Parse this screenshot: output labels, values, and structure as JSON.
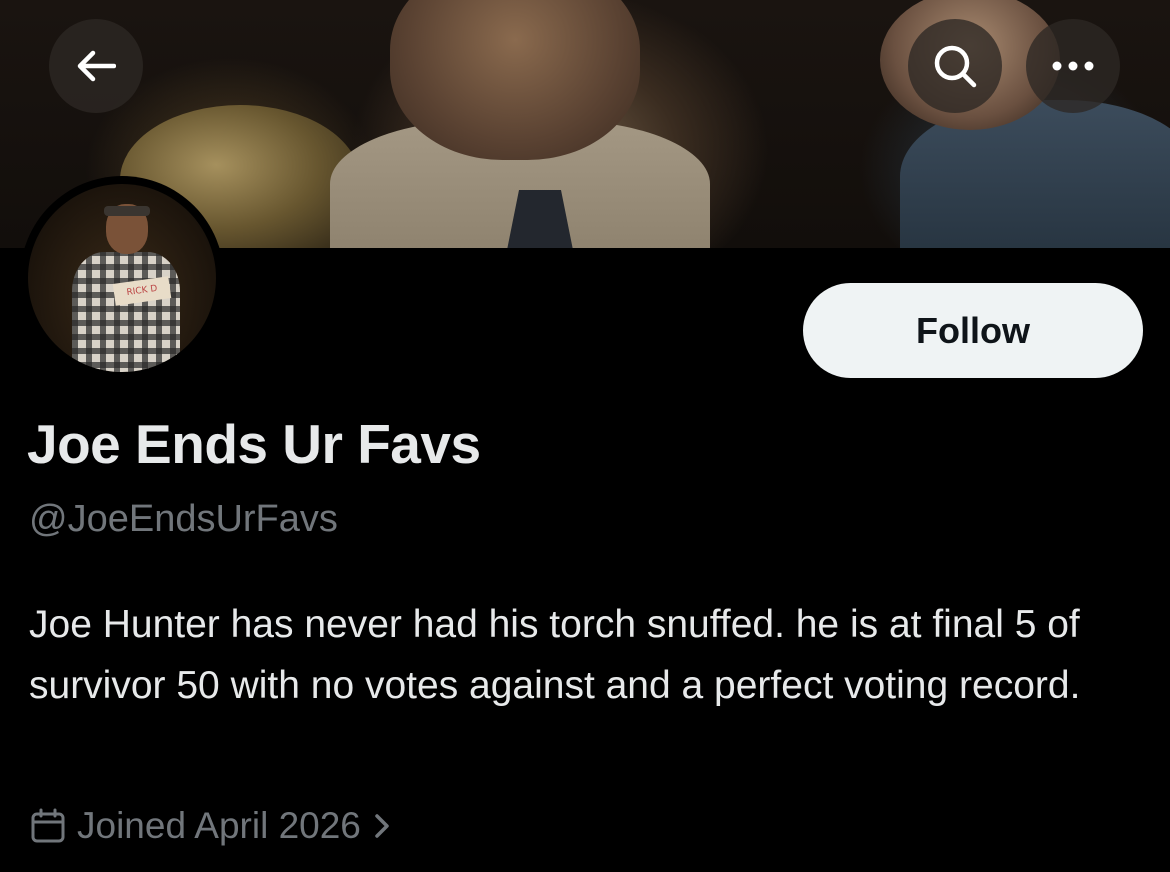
{
  "header": {
    "back_icon": "arrow-left-icon",
    "search_icon": "search-icon",
    "more_icon": "more-horizontal-icon"
  },
  "profile": {
    "display_name": "Joe Ends Ur Favs",
    "handle": "@JoeEndsUrFavs",
    "bio": "Joe Hunter has never had his torch snuffed. he is at final 5 of survivor 50 with no votes against and a perfect voting record.",
    "joined": "Joined April 2026",
    "avatar_card_text": "RICK D"
  },
  "actions": {
    "follow_label": "Follow"
  },
  "colors": {
    "background": "#000000",
    "primary_text": "#e7e9ea",
    "secondary_text": "#71767b",
    "follow_bg": "#eff3f4",
    "follow_text": "#0f1419"
  }
}
